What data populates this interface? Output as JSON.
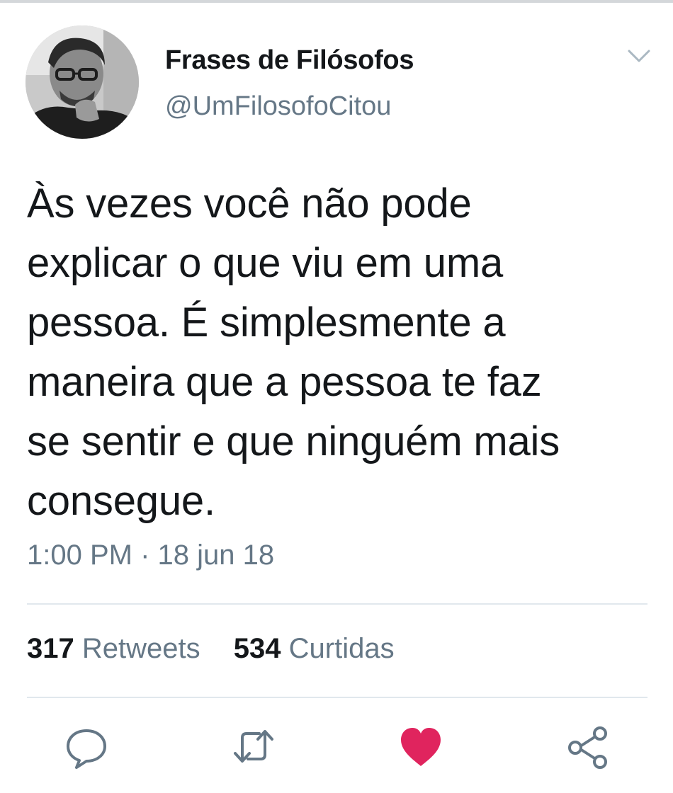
{
  "tweet": {
    "display_name": "Frases de Filósofos",
    "handle": "@UmFilosofoCitou",
    "text_lines": [
      "Às vezes você não pode",
      "explicar o que viu em uma",
      "pessoa. É simplesmente a",
      "maneira que a pessoa te faz",
      "se sentir e que ninguém mais",
      "consegue."
    ],
    "timestamp": "1:00 PM · 18 jun 18",
    "stats": {
      "retweets_count": "317",
      "retweets_label": "Retweets",
      "likes_count": "534",
      "likes_label": "Curtidas"
    }
  },
  "icons": {
    "menu": "chevron-down-icon",
    "reply": "reply-bubble-icon",
    "retweet": "retweet-arrows-icon",
    "like": "heart-icon",
    "share": "share-nodes-icon"
  },
  "colors": {
    "text": "#14171a",
    "secondary": "#657786",
    "divider": "#e1e8ed",
    "like_active": "#e0245e",
    "icon_gray": "#657786"
  },
  "state": {
    "liked": true
  }
}
